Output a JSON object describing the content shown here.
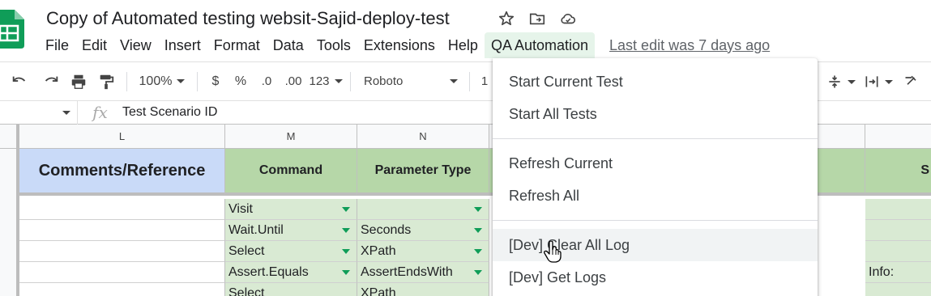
{
  "title": "Copy of Automated testing websit-Sajid-deploy-test",
  "menu": [
    "File",
    "Edit",
    "View",
    "Insert",
    "Format",
    "Data",
    "Tools",
    "Extensions",
    "Help",
    "QA Automation"
  ],
  "last_edit": "Last edit was 7 days ago",
  "toolbar": {
    "zoom": "100%",
    "currency": "$",
    "percent": "%",
    "decrease_decimal": ".0",
    "increase_decimal": ".00",
    "format_more": "123",
    "font": "Roboto",
    "font_size": "1"
  },
  "formula": {
    "fx": "fx",
    "value": "Test Scenario ID"
  },
  "columns": [
    "L",
    "M",
    "N"
  ],
  "headers": {
    "L": "Comments/Reference",
    "M": "Command",
    "N": "Parameter Type",
    "far": "S"
  },
  "rows": [
    {
      "m": "Visit",
      "n": "",
      "far": ""
    },
    {
      "m": "Wait.Until",
      "n": "Seconds",
      "far": ""
    },
    {
      "m": "Select",
      "n": "XPath",
      "far": ""
    },
    {
      "m": "Assert.Equals",
      "n": "AssertEndsWith",
      "far": "Info:"
    },
    {
      "m": "Select",
      "n": "XPath",
      "far": ""
    }
  ],
  "dropdown": {
    "items": [
      "Start Current Test",
      "Start All Tests",
      "Refresh Current",
      "Refresh All",
      "[Dev] Clear All Log",
      "[Dev] Get Logs"
    ]
  },
  "colors": {
    "header_blue": "#c9daf8",
    "header_green": "#b6d7a8",
    "cell_green": "#d9ead3",
    "menu_active": "#e6f4ea"
  }
}
